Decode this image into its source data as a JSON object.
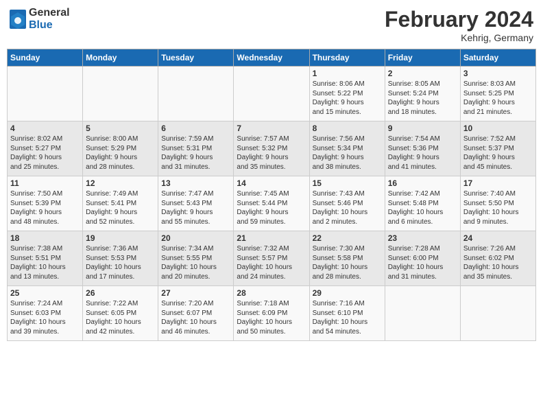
{
  "header": {
    "logo_general": "General",
    "logo_blue": "Blue",
    "month_title": "February 2024",
    "location": "Kehrig, Germany"
  },
  "days_of_week": [
    "Sunday",
    "Monday",
    "Tuesday",
    "Wednesday",
    "Thursday",
    "Friday",
    "Saturday"
  ],
  "weeks": [
    [
      {
        "day": "",
        "info": ""
      },
      {
        "day": "",
        "info": ""
      },
      {
        "day": "",
        "info": ""
      },
      {
        "day": "",
        "info": ""
      },
      {
        "day": "1",
        "info": "Sunrise: 8:06 AM\nSunset: 5:22 PM\nDaylight: 9 hours\nand 15 minutes."
      },
      {
        "day": "2",
        "info": "Sunrise: 8:05 AM\nSunset: 5:24 PM\nDaylight: 9 hours\nand 18 minutes."
      },
      {
        "day": "3",
        "info": "Sunrise: 8:03 AM\nSunset: 5:25 PM\nDaylight: 9 hours\nand 21 minutes."
      }
    ],
    [
      {
        "day": "4",
        "info": "Sunrise: 8:02 AM\nSunset: 5:27 PM\nDaylight: 9 hours\nand 25 minutes."
      },
      {
        "day": "5",
        "info": "Sunrise: 8:00 AM\nSunset: 5:29 PM\nDaylight: 9 hours\nand 28 minutes."
      },
      {
        "day": "6",
        "info": "Sunrise: 7:59 AM\nSunset: 5:31 PM\nDaylight: 9 hours\nand 31 minutes."
      },
      {
        "day": "7",
        "info": "Sunrise: 7:57 AM\nSunset: 5:32 PM\nDaylight: 9 hours\nand 35 minutes."
      },
      {
        "day": "8",
        "info": "Sunrise: 7:56 AM\nSunset: 5:34 PM\nDaylight: 9 hours\nand 38 minutes."
      },
      {
        "day": "9",
        "info": "Sunrise: 7:54 AM\nSunset: 5:36 PM\nDaylight: 9 hours\nand 41 minutes."
      },
      {
        "day": "10",
        "info": "Sunrise: 7:52 AM\nSunset: 5:37 PM\nDaylight: 9 hours\nand 45 minutes."
      }
    ],
    [
      {
        "day": "11",
        "info": "Sunrise: 7:50 AM\nSunset: 5:39 PM\nDaylight: 9 hours\nand 48 minutes."
      },
      {
        "day": "12",
        "info": "Sunrise: 7:49 AM\nSunset: 5:41 PM\nDaylight: 9 hours\nand 52 minutes."
      },
      {
        "day": "13",
        "info": "Sunrise: 7:47 AM\nSunset: 5:43 PM\nDaylight: 9 hours\nand 55 minutes."
      },
      {
        "day": "14",
        "info": "Sunrise: 7:45 AM\nSunset: 5:44 PM\nDaylight: 9 hours\nand 59 minutes."
      },
      {
        "day": "15",
        "info": "Sunrise: 7:43 AM\nSunset: 5:46 PM\nDaylight: 10 hours\nand 2 minutes."
      },
      {
        "day": "16",
        "info": "Sunrise: 7:42 AM\nSunset: 5:48 PM\nDaylight: 10 hours\nand 6 minutes."
      },
      {
        "day": "17",
        "info": "Sunrise: 7:40 AM\nSunset: 5:50 PM\nDaylight: 10 hours\nand 9 minutes."
      }
    ],
    [
      {
        "day": "18",
        "info": "Sunrise: 7:38 AM\nSunset: 5:51 PM\nDaylight: 10 hours\nand 13 minutes."
      },
      {
        "day": "19",
        "info": "Sunrise: 7:36 AM\nSunset: 5:53 PM\nDaylight: 10 hours\nand 17 minutes."
      },
      {
        "day": "20",
        "info": "Sunrise: 7:34 AM\nSunset: 5:55 PM\nDaylight: 10 hours\nand 20 minutes."
      },
      {
        "day": "21",
        "info": "Sunrise: 7:32 AM\nSunset: 5:57 PM\nDaylight: 10 hours\nand 24 minutes."
      },
      {
        "day": "22",
        "info": "Sunrise: 7:30 AM\nSunset: 5:58 PM\nDaylight: 10 hours\nand 28 minutes."
      },
      {
        "day": "23",
        "info": "Sunrise: 7:28 AM\nSunset: 6:00 PM\nDaylight: 10 hours\nand 31 minutes."
      },
      {
        "day": "24",
        "info": "Sunrise: 7:26 AM\nSunset: 6:02 PM\nDaylight: 10 hours\nand 35 minutes."
      }
    ],
    [
      {
        "day": "25",
        "info": "Sunrise: 7:24 AM\nSunset: 6:03 PM\nDaylight: 10 hours\nand 39 minutes."
      },
      {
        "day": "26",
        "info": "Sunrise: 7:22 AM\nSunset: 6:05 PM\nDaylight: 10 hours\nand 42 minutes."
      },
      {
        "day": "27",
        "info": "Sunrise: 7:20 AM\nSunset: 6:07 PM\nDaylight: 10 hours\nand 46 minutes."
      },
      {
        "day": "28",
        "info": "Sunrise: 7:18 AM\nSunset: 6:09 PM\nDaylight: 10 hours\nand 50 minutes."
      },
      {
        "day": "29",
        "info": "Sunrise: 7:16 AM\nSunset: 6:10 PM\nDaylight: 10 hours\nand 54 minutes."
      },
      {
        "day": "",
        "info": ""
      },
      {
        "day": "",
        "info": ""
      }
    ]
  ]
}
